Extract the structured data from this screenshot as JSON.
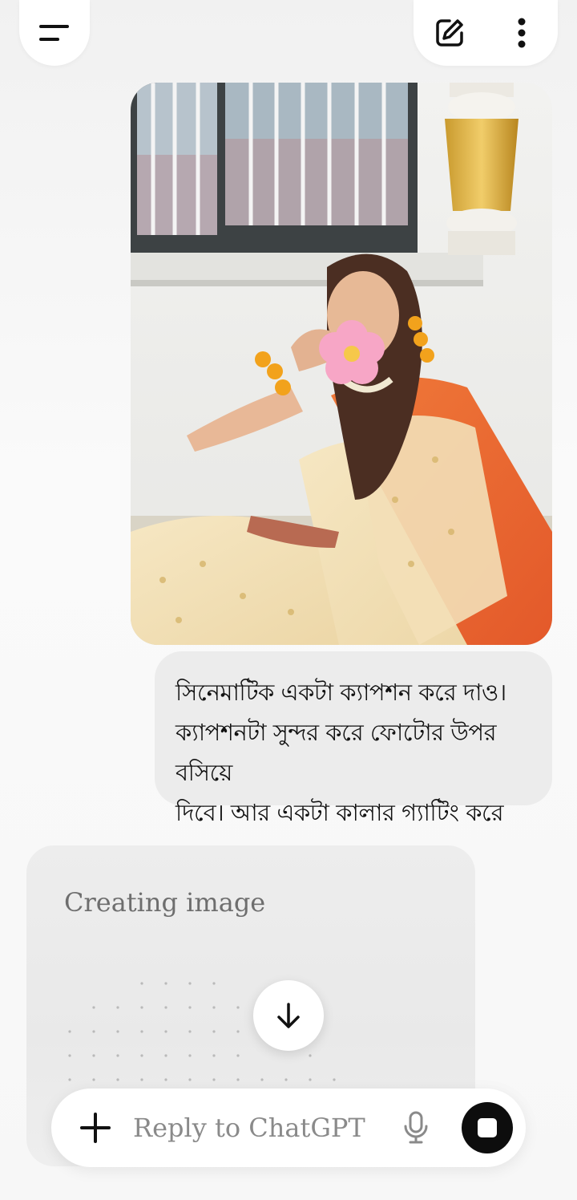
{
  "header": {
    "menu_icon": "menu-icon",
    "new_chat_icon": "edit-icon",
    "more_icon": "more-vertical-icon"
  },
  "message": {
    "image_alt": "Uploaded photo",
    "text_line1": "সিনেমাটিক একটা ক্যাপশন করে দাও।",
    "text_line2": "ক্যাপশনটা সুন্দর করে ফোটোর উপর বসিয়ে",
    "text_line3": "দিবে। আর একটা কালার গ্যাটিং করে দেবে।"
  },
  "assistant": {
    "status": "Creating image"
  },
  "scroll": {
    "icon": "arrow-down-icon"
  },
  "composer": {
    "placeholder": "Reply to ChatGPT",
    "value": "",
    "plus_icon": "plus-icon",
    "mic_icon": "microphone-icon",
    "stop_icon": "stop-icon"
  },
  "colors": {
    "accent": "#0d0d0d",
    "bubble": "#ececec",
    "background": "#f4f4f4"
  }
}
